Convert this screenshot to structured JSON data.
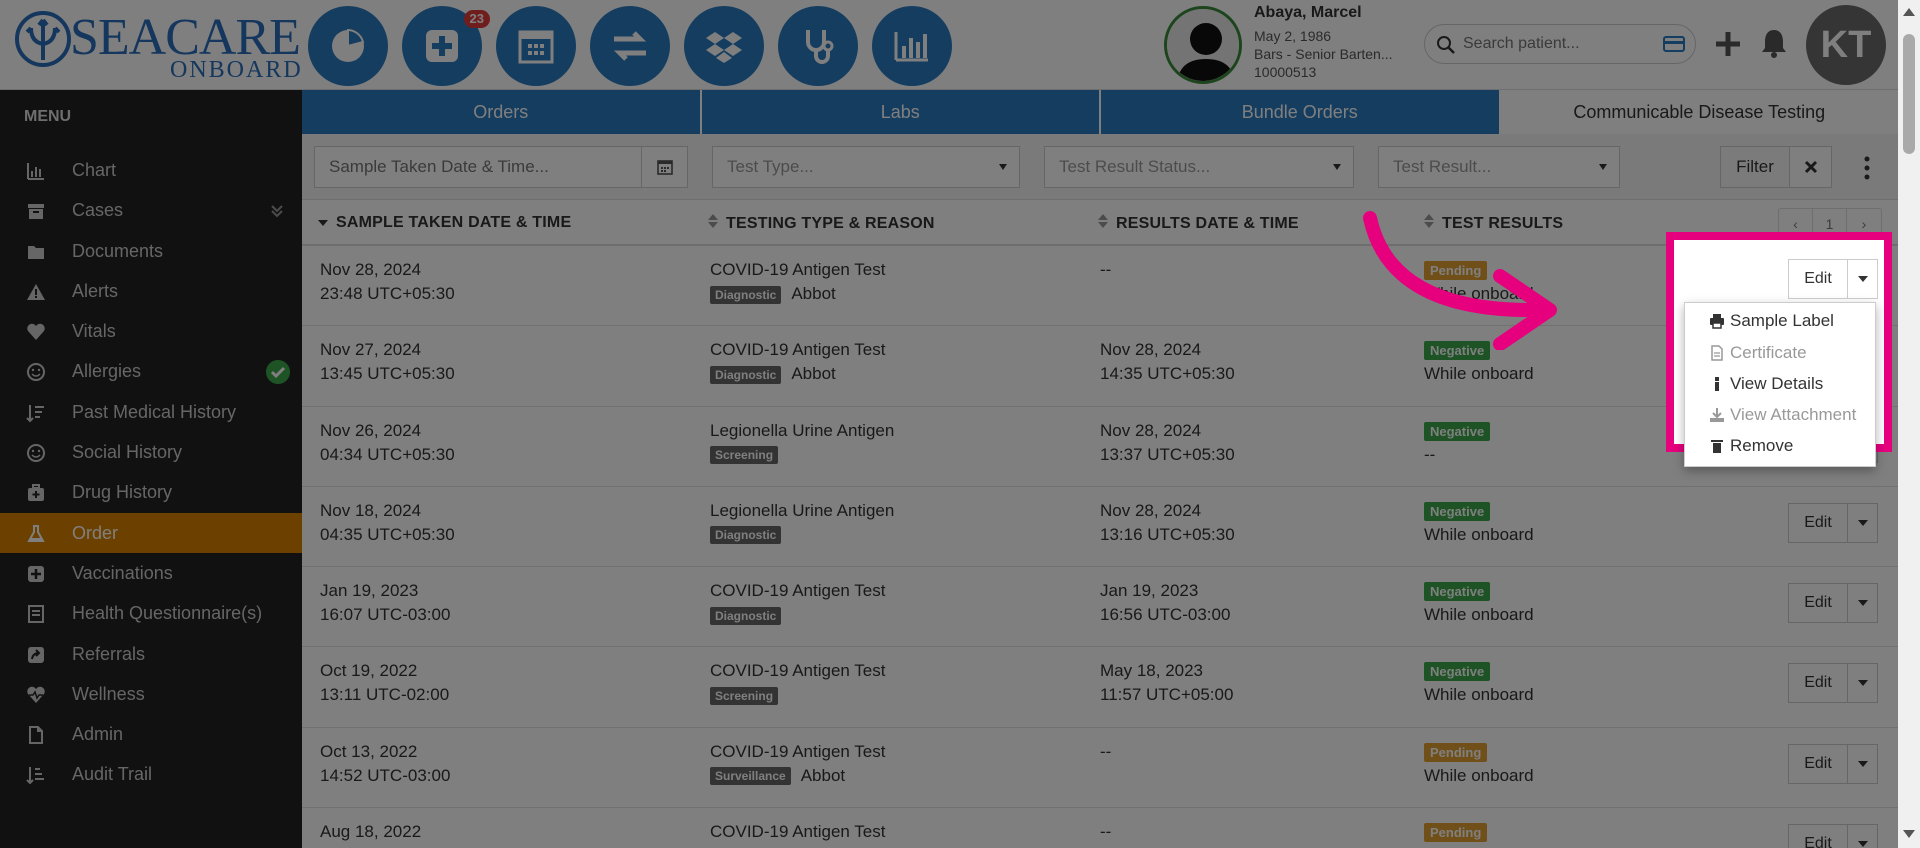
{
  "header": {
    "logo_main": "SEACARE",
    "logo_sub": "ONBOARD",
    "notification_count": "23",
    "nav_icons": [
      "pie-chart-icon",
      "medical-plus-icon",
      "calendar-icon",
      "transfer-icon",
      "dropbox-icon",
      "stethoscope-icon",
      "bar-chart-icon"
    ],
    "patient": {
      "name": "Abaya, Marcel",
      "dob": "May 2, 1986",
      "role": "Bars - Senior Barten...",
      "id": "10000513"
    },
    "search_placeholder": "Search patient...",
    "user_initials": "KT"
  },
  "sidebar": {
    "title": "MENU",
    "items": [
      {
        "label": "Chart",
        "icon": "bar-chart-icon"
      },
      {
        "label": "Cases",
        "icon": "box-icon"
      },
      {
        "label": "Documents",
        "icon": "folder-icon"
      },
      {
        "label": "Alerts",
        "icon": "warning-icon"
      },
      {
        "label": "Vitals",
        "icon": "heart-icon"
      },
      {
        "label": "Allergies",
        "icon": "smile-icon"
      },
      {
        "label": "Past Medical History",
        "icon": "sort-list-icon"
      },
      {
        "label": "Social History",
        "icon": "smile-icon"
      },
      {
        "label": "Drug History",
        "icon": "medkit-icon"
      },
      {
        "label": "Order",
        "icon": "flask-icon"
      },
      {
        "label": "Vaccinations",
        "icon": "plus-square-icon"
      },
      {
        "label": "Health Questionnaire(s)",
        "icon": "form-icon"
      },
      {
        "label": "Referrals",
        "icon": "share-icon"
      },
      {
        "label": "Wellness",
        "icon": "heartbeat-icon"
      },
      {
        "label": "Admin",
        "icon": "file-icon"
      },
      {
        "label": "Audit Trail",
        "icon": "sort-list-icon"
      }
    ]
  },
  "tabs": [
    "Orders",
    "Labs",
    "Bundle Orders",
    "Communicable Disease Testing"
  ],
  "filters": {
    "date_placeholder": "Sample Taken Date & Time...",
    "test_type": "Test Type...",
    "test_result_status": "Test Result Status...",
    "test_result": "Test Result...",
    "filter_label": "Filter"
  },
  "table": {
    "headers": [
      "SAMPLE TAKEN DATE & TIME",
      "TESTING TYPE & REASON",
      "RESULTS DATE & TIME",
      "TEST RESULTS"
    ],
    "pager": [
      "‹",
      "1",
      "›"
    ],
    "edit_label": "Edit",
    "rows": [
      {
        "date": "Nov 28, 2024",
        "time": "23:48 UTC+05:30",
        "test": "COVID-19 Antigen Test",
        "reason": "Diagnostic",
        "maker": "Abbot",
        "res_date": "--",
        "res_time": "",
        "status": "Pending",
        "result": "While onboard"
      },
      {
        "date": "Nov 27, 2024",
        "time": "13:45 UTC+05:30",
        "test": "COVID-19 Antigen Test",
        "reason": "Diagnostic",
        "maker": "Abbot",
        "res_date": "Nov 28, 2024",
        "res_time": "14:35 UTC+05:30",
        "status": "Negative",
        "result": "While onboard"
      },
      {
        "date": "Nov 26, 2024",
        "time": "04:34 UTC+05:30",
        "test": "Legionella Urine Antigen",
        "reason": "Screening",
        "maker": "",
        "res_date": "Nov 28, 2024",
        "res_time": "13:37 UTC+05:30",
        "status": "Negative",
        "result": "--"
      },
      {
        "date": "Nov 18, 2024",
        "time": "04:35 UTC+05:30",
        "test": "Legionella Urine Antigen",
        "reason": "Diagnostic",
        "maker": "",
        "res_date": "Nov 28, 2024",
        "res_time": "13:16 UTC+05:30",
        "status": "Negative",
        "result": "While onboard"
      },
      {
        "date": "Jan 19, 2023",
        "time": "16:07 UTC-03:00",
        "test": "COVID-19 Antigen Test",
        "reason": "Diagnostic",
        "maker": "",
        "res_date": "Jan 19, 2023",
        "res_time": "16:56 UTC-03:00",
        "status": "Negative",
        "result": "While onboard"
      },
      {
        "date": "Oct 19, 2022",
        "time": "13:11 UTC-02:00",
        "test": "COVID-19 Antigen Test",
        "reason": "Screening",
        "maker": "",
        "res_date": "May 18, 2023",
        "res_time": "11:57 UTC+05:00",
        "status": "Negative",
        "result": "While onboard"
      },
      {
        "date": "Oct 13, 2022",
        "time": "14:52 UTC-03:00",
        "test": "COVID-19 Antigen Test",
        "reason": "Surveillance",
        "maker": "Abbot",
        "res_date": "--",
        "res_time": "",
        "status": "Pending",
        "result": "While onboard"
      },
      {
        "date": "Aug 18, 2022",
        "time": "",
        "test": "COVID-19 Antigen Test",
        "reason": "",
        "maker": "",
        "res_date": "--",
        "res_time": "",
        "status": "Pending",
        "result": ""
      }
    ]
  },
  "dropdown": {
    "items": [
      {
        "label": "Sample Label",
        "icon": "print-icon",
        "disabled": false
      },
      {
        "label": "Certificate",
        "icon": "file-icon",
        "disabled": true
      },
      {
        "label": "View Details",
        "icon": "info-icon",
        "disabled": false
      },
      {
        "label": "View Attachment",
        "icon": "download-icon",
        "disabled": true
      },
      {
        "label": "Remove",
        "icon": "trash-icon",
        "disabled": false
      }
    ]
  },
  "colors": {
    "brand_blue": "#2a7ac0",
    "sidebar_bg": "#222222",
    "active_orange": "#d98300",
    "pending": "#e0a030",
    "negative": "#3aa64a",
    "highlight_magenta": "#e6007e"
  }
}
